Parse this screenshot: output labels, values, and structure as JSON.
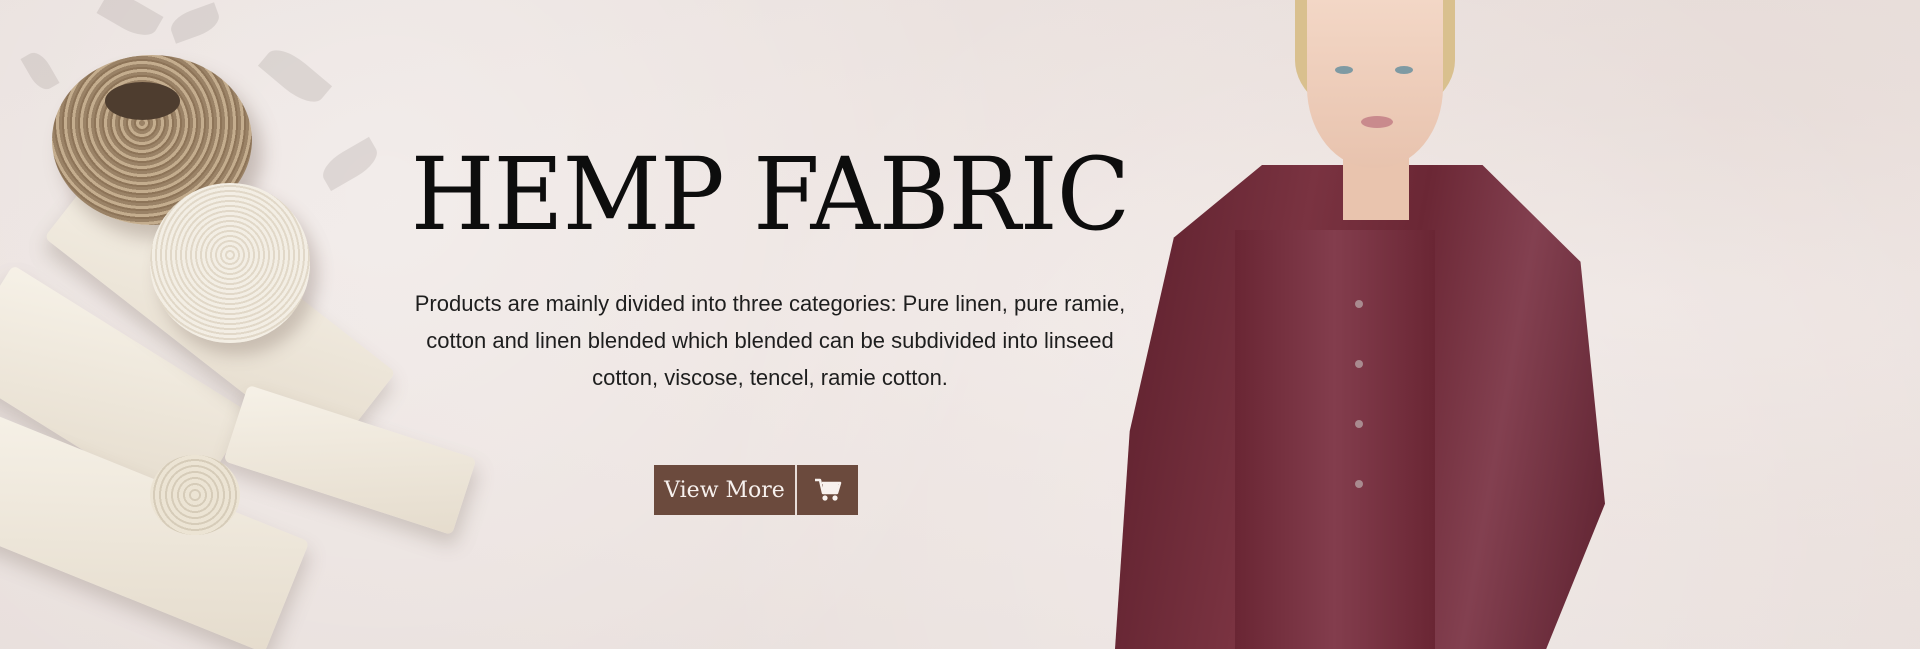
{
  "banner": {
    "title": "HEMP FABRIC",
    "description": "Products are mainly divided into three categories: Pure linen, pure ramie, cotton and linen blended which blended can be subdivided into linseed cotton, viscose, tencel, ramie cotton.",
    "cta": {
      "label": "View More",
      "icon": "cart-icon"
    }
  },
  "colors": {
    "accent": "#6b4a3d",
    "background": "#efe7e4",
    "title_text": "#0d0d0d",
    "garment": "#6b2735"
  }
}
